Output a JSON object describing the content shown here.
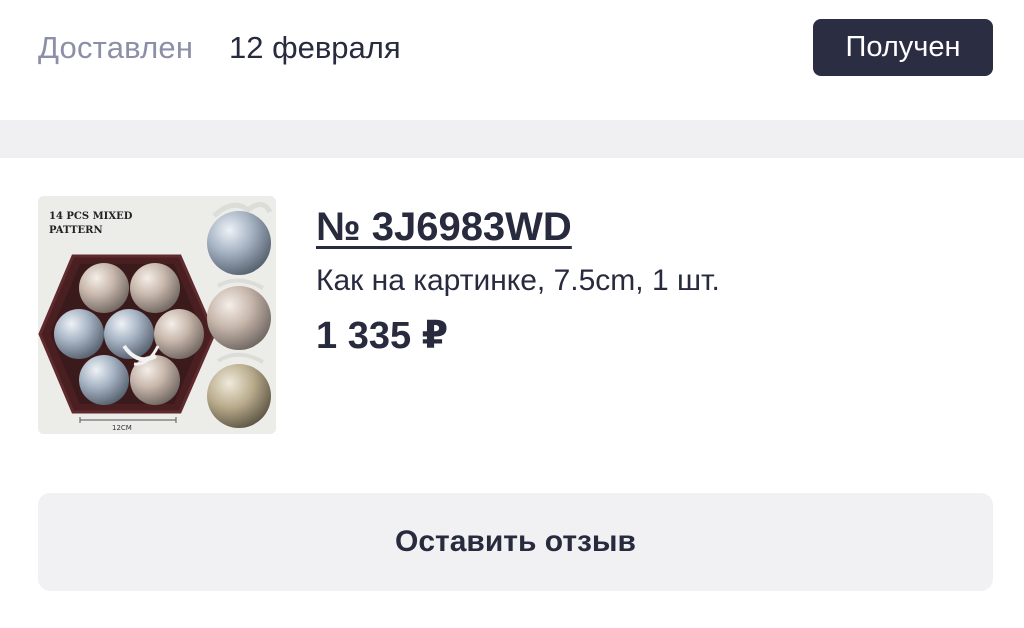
{
  "order": {
    "status_label": "Доставлен",
    "status_date": "12 февраля",
    "received_button": "Получен"
  },
  "product": {
    "number": "№ 3J6983WD",
    "description": "Как на картинке, 7.5cm, 1 шт.",
    "price": "1 335 ₽",
    "image": {
      "caption_line1": "14 PCS MIXED",
      "caption_line2": "PATTERN",
      "size_label": "12CM"
    }
  },
  "actions": {
    "review_button": "Оставить отзыв"
  },
  "colors": {
    "primary_dark": "#2b2d43",
    "text_primary": "#282a3e",
    "text_muted": "#8c8fa8",
    "separator": "#f0f0f2",
    "button_light": "#f1f1f3"
  }
}
